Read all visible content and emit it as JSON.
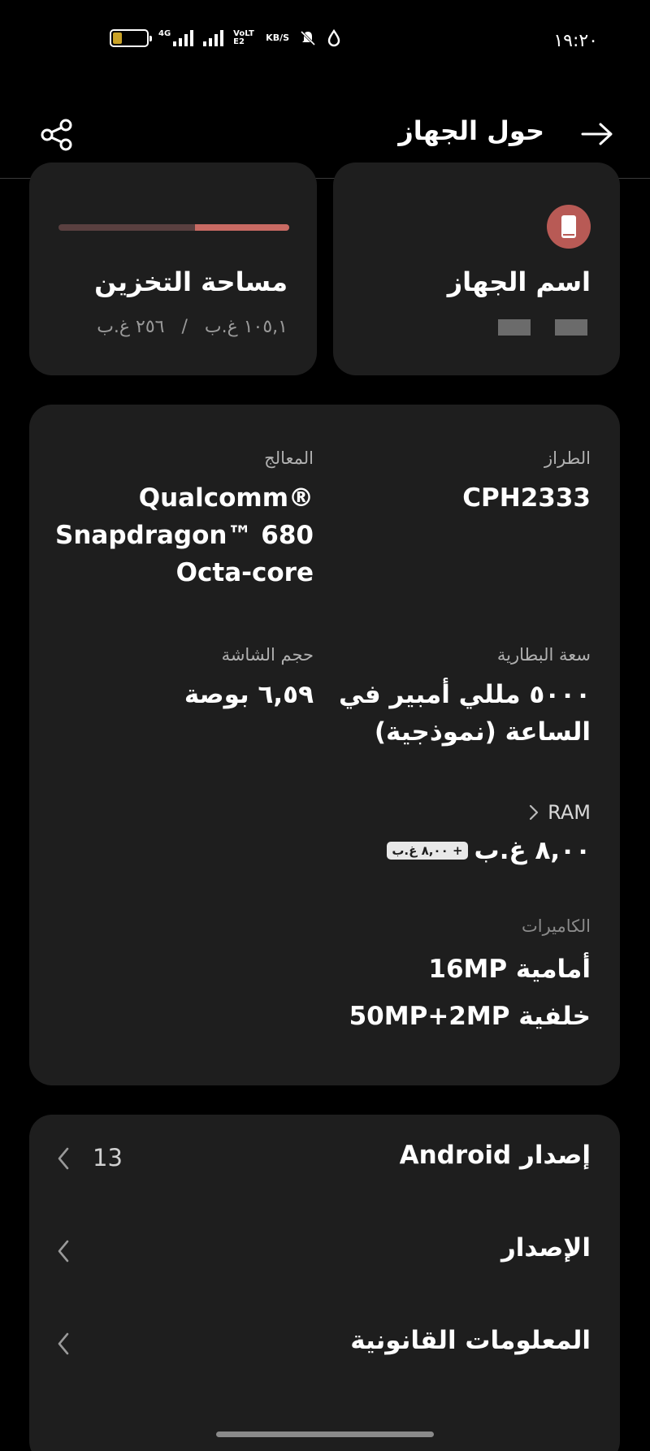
{
  "status_bar": {
    "time": "١٩:٢٠",
    "battery_level": "٢٨",
    "battery_percent": 28,
    "network_type": "4G",
    "volte_label": "VoLTE2",
    "speed_unit": "KB/S"
  },
  "header": {
    "title": "حول الجهاز"
  },
  "device_card": {
    "title": "اسم الجهاز"
  },
  "storage_card": {
    "title": "مساحة التخزين",
    "used": "١٠٥,١ غ.ب",
    "separator": "/",
    "total": "٢٥٦ غ.ب",
    "used_fraction": 0.41
  },
  "specs": {
    "model": {
      "label": "الطراز",
      "value": "CPH2333"
    },
    "processor": {
      "label": "المعالج",
      "lines": [
        "Qualcomm®",
        "Snapdragon™ 680",
        "Octa-core"
      ]
    },
    "battery": {
      "label": "سعة البطارية",
      "lines": [
        "٥٠٠٠ مللي أمبير في",
        "الساعة (نموذجية)"
      ]
    },
    "screen": {
      "label": "حجم الشاشة",
      "value": "٦,٥٩ بوصة"
    },
    "ram": {
      "label": "RAM",
      "value": "٨,٠٠ غ.ب",
      "extended": "+ ٨,٠٠ غ.ب"
    },
    "cameras": {
      "label": "الكاميرات",
      "front": "أمامية 16MP",
      "rear": "خلفية 50MP+2MP"
    }
  },
  "list": {
    "items": [
      {
        "label": "إصدار Android",
        "value": "13"
      },
      {
        "label": "الإصدار",
        "value": ""
      },
      {
        "label": "المعلومات القانونية",
        "value": ""
      }
    ]
  },
  "colors": {
    "background": "#000000",
    "card": "#1e1e1e",
    "accent": "#c96a63",
    "device_icon_bg": "#b85a55"
  }
}
